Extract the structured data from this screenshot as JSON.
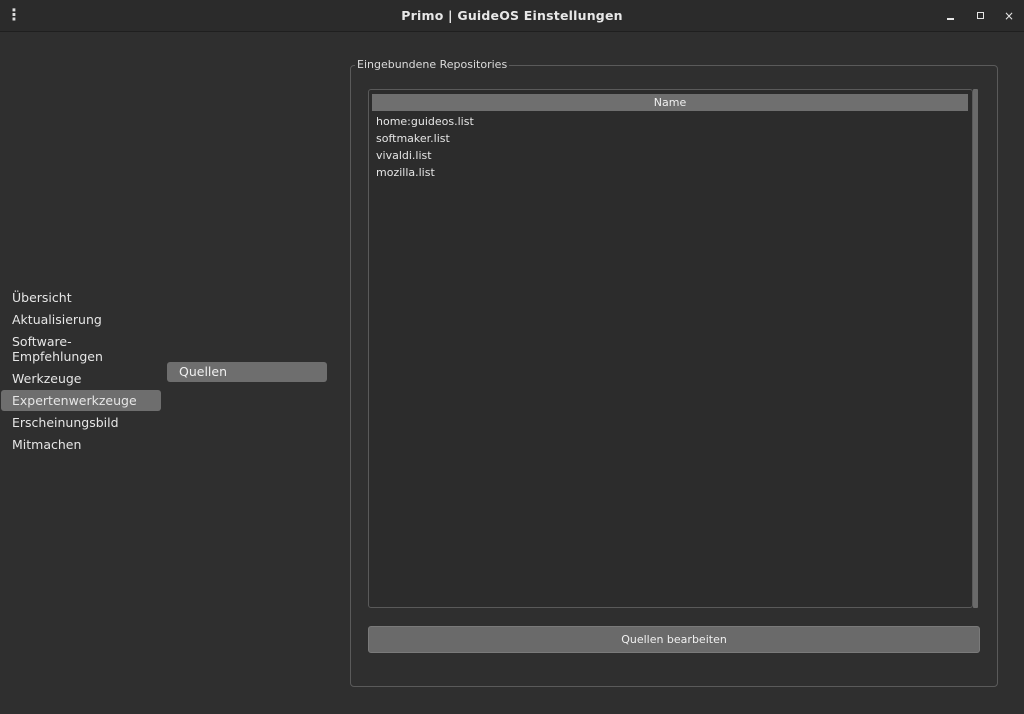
{
  "window": {
    "title": "Primo | GuideOS Einstellungen",
    "menu_icon": "kebab-menu-icon",
    "controls": [
      "minimize-icon",
      "maximize-icon",
      "close-icon"
    ],
    "close_glyph": "×"
  },
  "sidebar": {
    "items": [
      {
        "label": "Übersicht",
        "selected": false
      },
      {
        "label": "Aktualisierung",
        "selected": false
      },
      {
        "label": "Software-\nEmpfehlungen",
        "selected": false
      },
      {
        "label": "Werkzeuge",
        "selected": false
      },
      {
        "label": "Expertenwerkzeuge",
        "selected": true
      },
      {
        "label": "Erscheinungsbild",
        "selected": false
      },
      {
        "label": "Mitmachen",
        "selected": false
      }
    ]
  },
  "subnav": {
    "items": [
      {
        "label": "Quellen",
        "selected": true
      }
    ]
  },
  "repositories": {
    "group_title": "Eingebundene Repositories",
    "column_header": "Name",
    "rows": [
      "home:guideos.list",
      "softmaker.list",
      "vivaldi.list",
      "mozilla.list"
    ],
    "edit_button": "Quellen bearbeiten"
  },
  "colors": {
    "background": "#2f2f2f",
    "selection": "#6e6e6e",
    "text": "#e6e6e6"
  }
}
